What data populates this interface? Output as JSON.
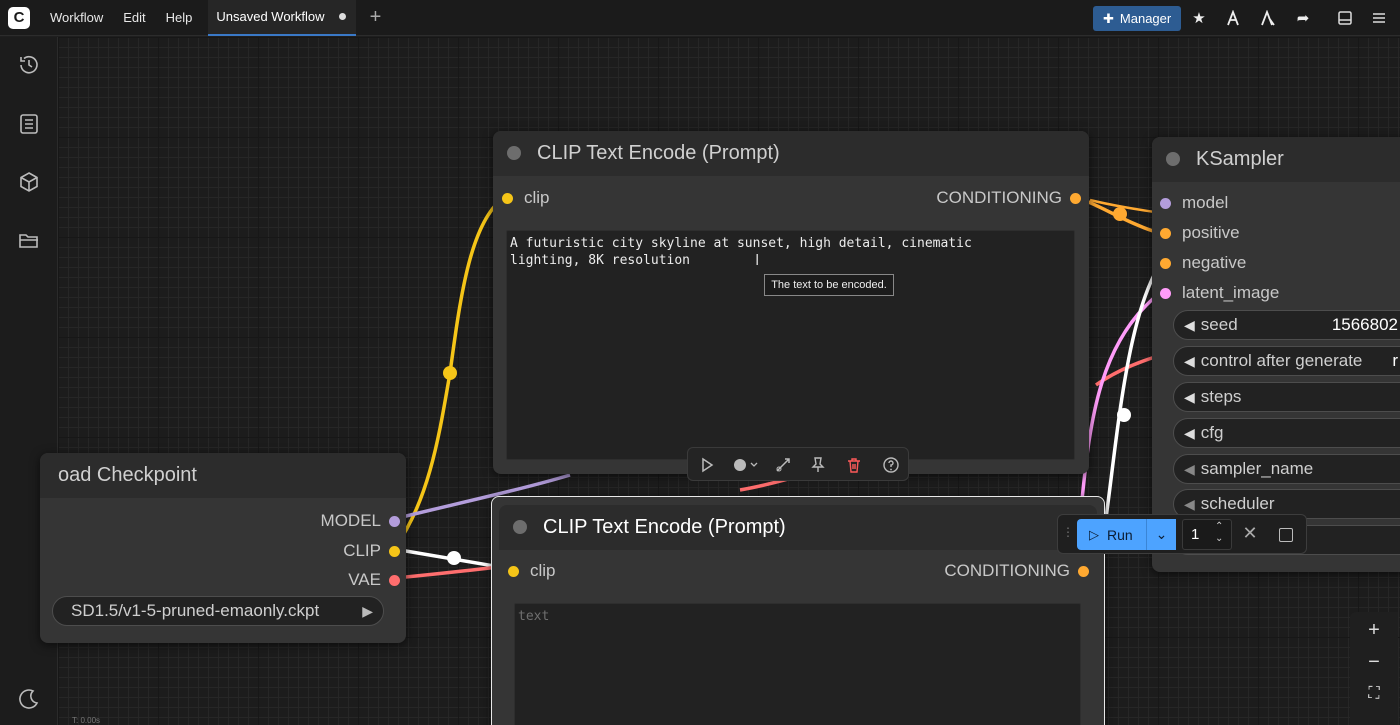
{
  "topbar": {
    "menu": [
      "Workflow",
      "Edit",
      "Help"
    ],
    "tab_label": "Unsaved Workflow",
    "manager_label": "Manager",
    "icons": [
      "star-icon",
      "node-library-icon",
      "model-library-icon",
      "share-icon",
      "layout-icon",
      "more-icon"
    ]
  },
  "sidebar": {
    "icons": [
      "history-icon",
      "queue-icon",
      "model-library-icon",
      "workflows-icon"
    ]
  },
  "nodes": {
    "clip_top": {
      "title": "CLIP Text Encode (Prompt)",
      "input": "clip",
      "output": "CONDITIONING",
      "text": "A futuristic city skyline at sunset, high detail, cinematic\nlighting, 8K resolution",
      "tooltip": "The text to be encoded."
    },
    "clip_bottom": {
      "title": "CLIP Text Encode (Prompt)",
      "input": "clip",
      "output": "CONDITIONING",
      "placeholder": "text"
    },
    "checkpoint": {
      "title": "oad Checkpoint",
      "outputs": [
        "MODEL",
        "CLIP",
        "VAE"
      ],
      "ckpt": "SD1.5/v1-5-pruned-emaonly.ckpt"
    },
    "ksampler": {
      "title": "KSampler",
      "inputs": [
        "model",
        "positive",
        "negative",
        "latent_image"
      ],
      "widgets": [
        {
          "label": "seed",
          "value": "1566802"
        },
        {
          "label": "control after generate",
          "value": "r"
        },
        {
          "label": "steps",
          "value": ""
        },
        {
          "label": "cfg",
          "value": ""
        },
        {
          "label": "sampler_name",
          "value": ""
        },
        {
          "label": "scheduler",
          "value": ""
        }
      ]
    }
  },
  "runbar": {
    "run_label": "Run",
    "count": "1"
  },
  "status": "T: 0.00s",
  "colors": {
    "clip": "#f5c518",
    "model": "#b39ddb",
    "vae": "#ff6e6e",
    "conditioning": "#ffa931",
    "latent": "#ff9cf9",
    "accent": "#4da3ff"
  }
}
